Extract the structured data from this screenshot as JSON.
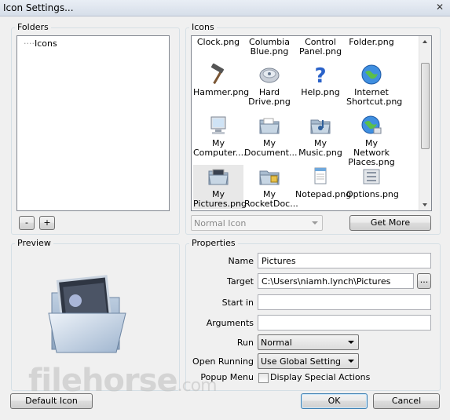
{
  "window": {
    "title": "Icon Settings...",
    "close_glyph": "✕"
  },
  "folders": {
    "label": "Folders",
    "tree_items": [
      "Icons"
    ],
    "remove_label": "-",
    "add_label": "+"
  },
  "icons": {
    "label": "Icons",
    "top_row": [
      "Clock.png",
      "Columbia Blue.png",
      "Control Panel.png",
      "Folder.png"
    ],
    "items": [
      {
        "label": "Hammer.png",
        "icon": "hammer-icon"
      },
      {
        "label": "Hard Drive.png",
        "icon": "hard-drive-icon"
      },
      {
        "label": "Help.png",
        "icon": "help-icon"
      },
      {
        "label": "Internet Shortcut.png",
        "icon": "internet-shortcut-icon"
      },
      {
        "label": "My Computer....",
        "icon": "computer-icon"
      },
      {
        "label": "My Document...",
        "icon": "documents-folder-icon"
      },
      {
        "label": "My Music.png",
        "icon": "music-folder-icon"
      },
      {
        "label": "My Network Places.png",
        "icon": "network-places-icon"
      },
      {
        "label": "My Pictures.png",
        "icon": "pictures-folder-icon",
        "selected": true
      },
      {
        "label": "My RocketDoc...",
        "icon": "rocketdock-folder-icon"
      },
      {
        "label": "Notepad.png",
        "icon": "notepad-icon"
      },
      {
        "label": "Options.png",
        "icon": "options-icon"
      }
    ],
    "icon_type_value": "Normal Icon",
    "get_more_label": "Get More"
  },
  "preview": {
    "label": "Preview",
    "icon": "pictures-folder-icon"
  },
  "properties": {
    "label": "Properties",
    "name_label": "Name",
    "name_value": "Pictures",
    "target_label": "Target",
    "target_value": "C:\\Users\\niamh.lynch\\Pictures",
    "browse_label": "...",
    "startin_label": "Start in",
    "startin_value": "",
    "arguments_label": "Arguments",
    "arguments_value": "",
    "run_label": "Run",
    "run_value": "Normal",
    "open_running_label": "Open Running",
    "open_running_value": "Use Global Setting",
    "popup_menu_label": "Popup Menu",
    "popup_checkbox_label": "Display Special Actions"
  },
  "buttons": {
    "default_icon": "Default Icon",
    "ok": "OK",
    "cancel": "Cancel"
  },
  "watermark": {
    "brand": "filehorse",
    "tld": ".com"
  }
}
